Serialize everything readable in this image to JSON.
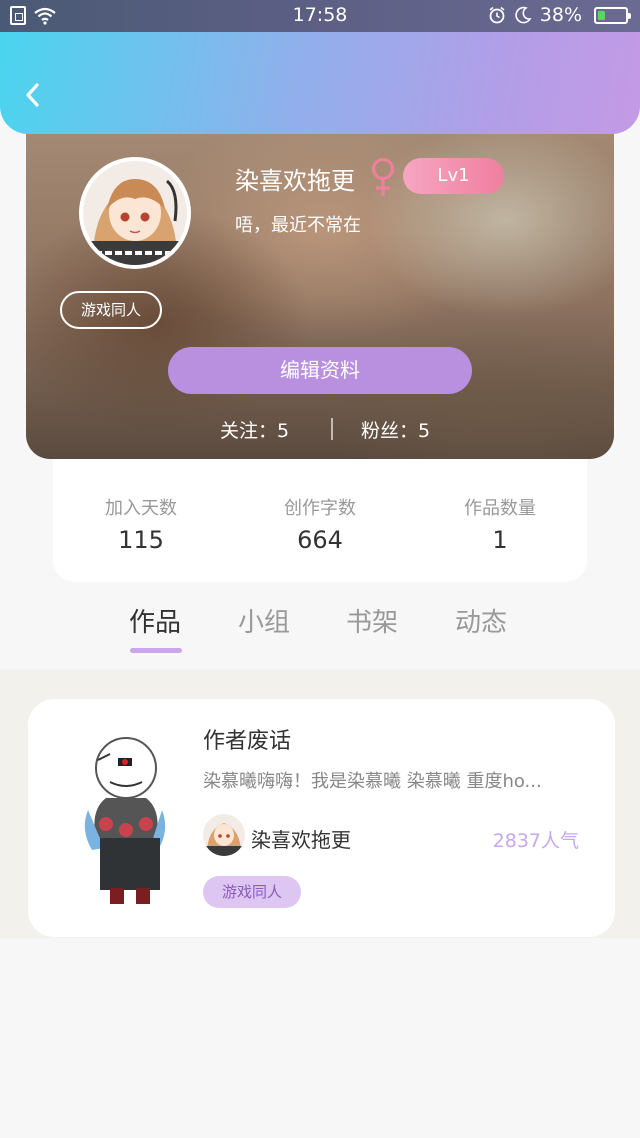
{
  "status_bar": {
    "time": "17:58",
    "battery_percent_label": "38%",
    "battery_level": 0.38,
    "icons": [
      "sim-icon",
      "wifi-icon",
      "alarm-icon",
      "moon-icon",
      "battery-icon"
    ]
  },
  "header": {
    "back_icon": "chevron-left-icon"
  },
  "profile": {
    "username": "染喜欢拖更",
    "gender_symbol": "♀",
    "level": "Lv1",
    "bio": "唔，最近不常在",
    "tag": "游戏同人",
    "edit_button": "编辑资料",
    "following": "关注：5",
    "followers": "粉丝：5"
  },
  "stats": [
    {
      "label": "加入天数",
      "value": "115"
    },
    {
      "label": "创作字数",
      "value": "664"
    },
    {
      "label": "作品数量",
      "value": "1"
    }
  ],
  "tabs": [
    {
      "label": "作品",
      "active": true
    },
    {
      "label": "小组",
      "active": false
    },
    {
      "label": "书架",
      "active": false
    },
    {
      "label": "动态",
      "active": false
    }
  ],
  "works": [
    {
      "title": "作者废话",
      "excerpt": "染慕曦嗨嗨！我是染慕曦 染慕曦 重度ho...",
      "author": "染喜欢拖更",
      "popularity": "2837人气",
      "tag": "游戏同人"
    }
  ],
  "colors": {
    "accent_purple": "#b98fe0",
    "level_pink": "#f07f9f",
    "header_start": "#4ad5ef",
    "header_end": "#c49ae6"
  }
}
